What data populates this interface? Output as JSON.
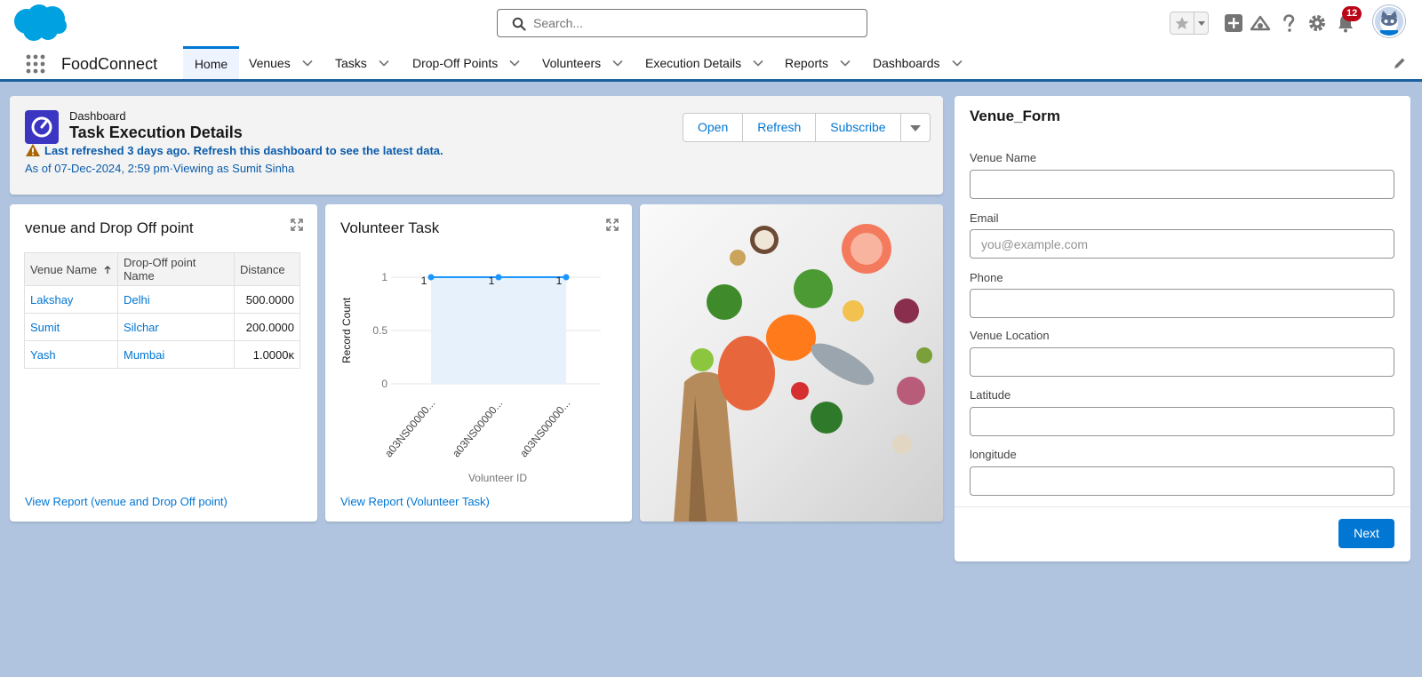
{
  "search": {
    "placeholder": "Search..."
  },
  "header": {
    "notification_count": "12"
  },
  "nav": {
    "app_name": "FoodConnect",
    "tabs": [
      {
        "label": "Home",
        "active": true
      },
      {
        "label": "Venues"
      },
      {
        "label": "Tasks"
      },
      {
        "label": "Drop-Off Points"
      },
      {
        "label": "Volunteers"
      },
      {
        "label": "Execution Details"
      },
      {
        "label": "Reports"
      },
      {
        "label": "Dashboards"
      }
    ]
  },
  "dashboard": {
    "kicker": "Dashboard",
    "title": "Task Execution Details",
    "warning": "Last refreshed 3 days ago. Refresh this dashboard to see the latest data.",
    "as_of": "As of 07-Dec-2024, 2:59 pm·Viewing as Sumit Sinha",
    "buttons": {
      "open": "Open",
      "refresh": "Refresh",
      "subscribe": "Subscribe"
    }
  },
  "venue_widget": {
    "title": "venue and Drop Off point",
    "columns": [
      "Venue Name",
      "Drop-Off point Name",
      "Distance"
    ],
    "rows": [
      {
        "venue": "Lakshay",
        "dropoff": "Delhi",
        "distance": "500.0000"
      },
      {
        "venue": "Sumit",
        "dropoff": "Silchar",
        "distance": "200.0000"
      },
      {
        "venue": "Yash",
        "dropoff": "Mumbai",
        "distance": "1.0000ĸ"
      }
    ],
    "view_report": "View Report (venue and Drop Off point)"
  },
  "volunteer_widget": {
    "title": "Volunteer Task",
    "view_report": "View Report (Volunteer Task)"
  },
  "chart_data": {
    "type": "area",
    "categories": [
      "a03NS00000...",
      "a03NS00000...",
      "a03NS00000..."
    ],
    "values": [
      1,
      1,
      1
    ],
    "data_labels": [
      "1",
      "1",
      "1"
    ],
    "xlabel": "Volunteer ID",
    "ylabel": "Record Count",
    "ylim": [
      0,
      1
    ],
    "yticks": [
      {
        "value": 1,
        "label": "1"
      },
      {
        "value": 0.5,
        "label": "0.5"
      },
      {
        "value": 0,
        "label": "0"
      }
    ],
    "grid": true,
    "legend": "none",
    "colors": {
      "line": "#1b96ff",
      "fill": "#e6f1fc"
    }
  },
  "form": {
    "title": "Venue_Form",
    "fields": [
      {
        "label": "Venue Name",
        "value": "",
        "placeholder": ""
      },
      {
        "label": "Email",
        "value": "",
        "placeholder": "you@example.com"
      },
      {
        "label": "Phone",
        "value": "",
        "placeholder": ""
      },
      {
        "label": "Venue Location",
        "value": "",
        "placeholder": ""
      },
      {
        "label": "Latitude",
        "value": "",
        "placeholder": ""
      },
      {
        "label": "longitude",
        "value": "",
        "placeholder": ""
      }
    ],
    "next_label": "Next"
  },
  "colors": {
    "brand_blue": "#0176d3",
    "link_blue": "#0b5cab",
    "page_bg": "#b0c4df",
    "dashboard_icon": "#3b36c2",
    "badge_red": "#ba0517"
  }
}
